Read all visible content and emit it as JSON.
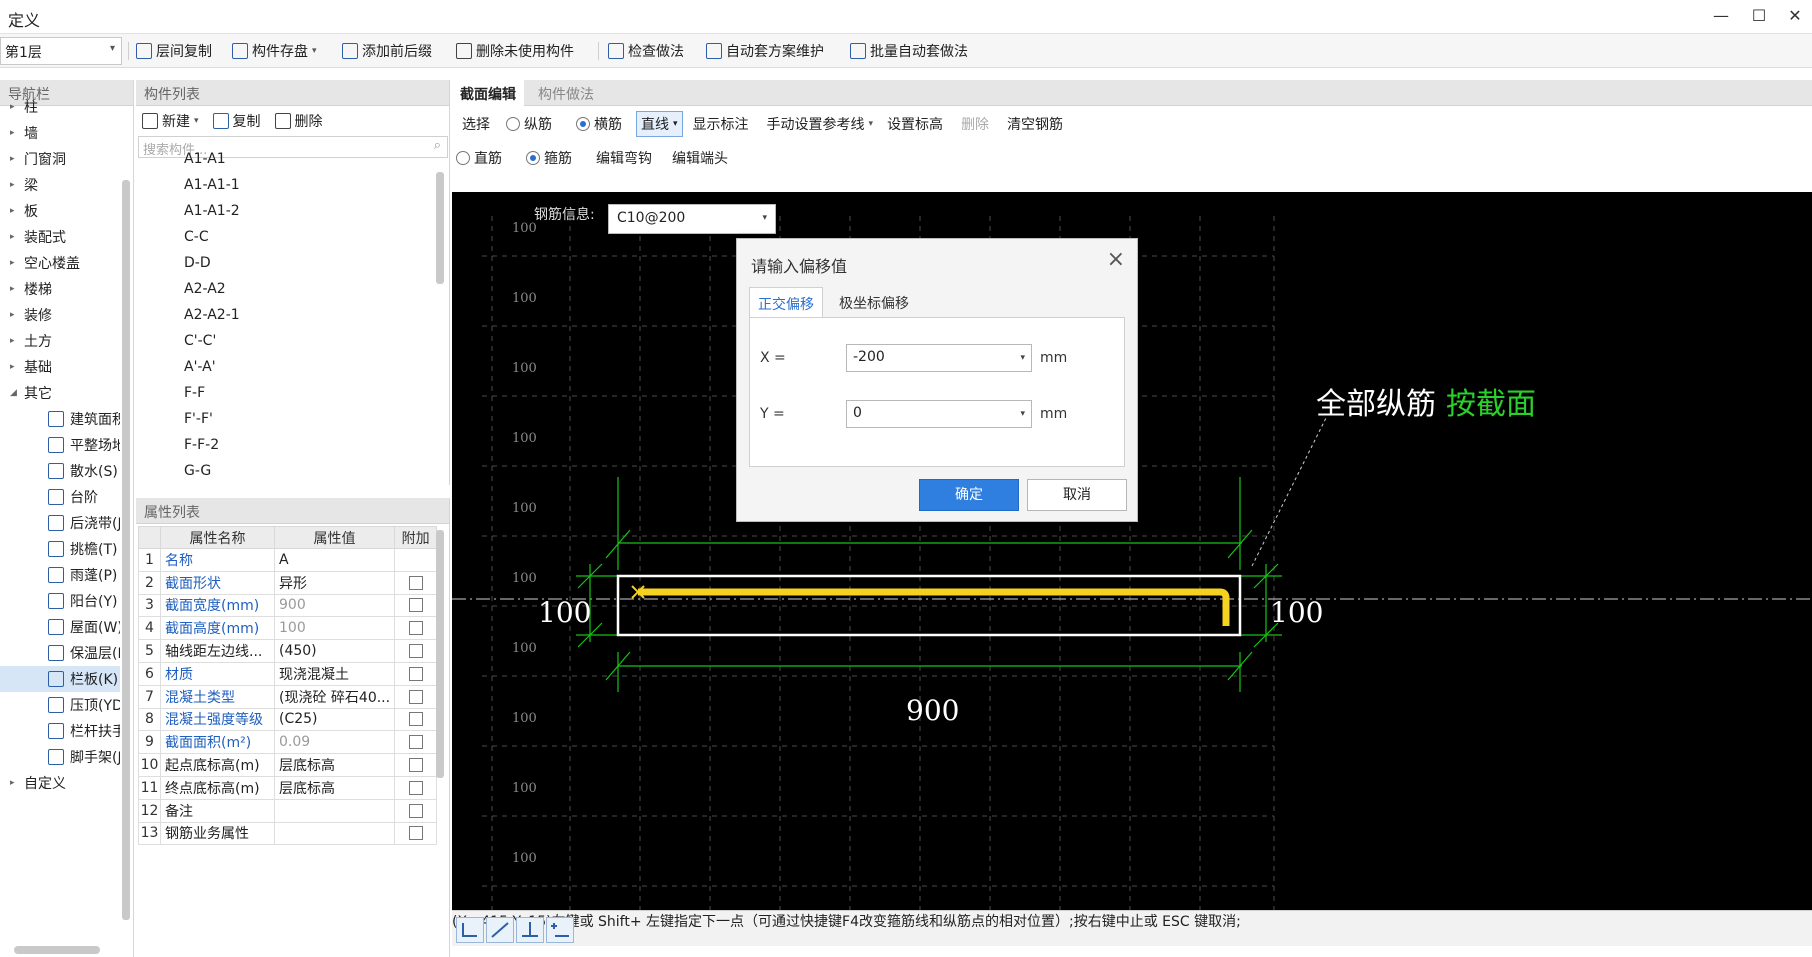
{
  "window": {
    "title": "定义",
    "minimize": "—",
    "maximize": "☐",
    "close": "✕"
  },
  "toolbar": {
    "floor": "第1层",
    "items": [
      "层间复制",
      "构件存盘",
      "添加前后缀",
      "删除未使用构件",
      "检查做法",
      "自动套方案维护",
      "批量自动套做法"
    ]
  },
  "nav": {
    "title": "导航栏",
    "items": [
      "柱",
      "墙",
      "门窗洞",
      "梁",
      "板",
      "装配式",
      "空心楼盖",
      "楼梯",
      "装修",
      "土方",
      "基础",
      "其它"
    ],
    "sub_items": [
      "建筑面积",
      "平整场地",
      "散水(S)",
      "台阶",
      "后浇带(J",
      "挑檐(T)",
      "雨蓬(P)",
      "阳台(Y)",
      "屋面(W)",
      "保温层(H",
      "栏板(K)",
      "压顶(YD)",
      "栏杆扶手",
      "脚手架(J"
    ],
    "last": "自定义"
  },
  "component_list": {
    "title": "构件列表",
    "new": "新建",
    "copy": "复制",
    "delete": "删除",
    "search_placeholder": "搜索构件...",
    "items": [
      "A1-A1",
      "A1-A1-1",
      "A1-A1-2",
      "C-C",
      "D-D",
      "A2-A2",
      "A2-A2-1",
      "C'-C'",
      "A'-A'",
      "F-F",
      "F'-F'",
      "F-F-2",
      "G-G"
    ]
  },
  "properties": {
    "title": "属性列表",
    "headers": [
      "属性名称",
      "属性值",
      "附加"
    ],
    "rows": [
      {
        "n": "1",
        "name": "名称",
        "value": "A"
      },
      {
        "n": "2",
        "name": "截面形状",
        "value": "异形"
      },
      {
        "n": "3",
        "name": "截面宽度(mm)",
        "value": "900"
      },
      {
        "n": "4",
        "name": "截面高度(mm)",
        "value": "100"
      },
      {
        "n": "5",
        "name": "轴线距左边线...",
        "value": "(450)"
      },
      {
        "n": "6",
        "name": "材质",
        "value": "现浇混凝土"
      },
      {
        "n": "7",
        "name": "混凝土类型",
        "value": "(现浇砼 碎石40..."
      },
      {
        "n": "8",
        "name": "混凝土强度等级",
        "value": "(C25)"
      },
      {
        "n": "9",
        "name": "截面面积(m²)",
        "value": "0.09"
      },
      {
        "n": "10",
        "name": "起点底标高(m)",
        "value": "层底标高"
      },
      {
        "n": "11",
        "name": "终点底标高(m)",
        "value": "层底标高"
      },
      {
        "n": "12",
        "name": "备注",
        "value": ""
      },
      {
        "n": "13",
        "name": "钢筋业务属性",
        "value": ""
      }
    ]
  },
  "editor": {
    "tabs": [
      "截面编辑",
      "构件做法"
    ],
    "tool1": {
      "select": "选择",
      "longitudinal": "纵筋",
      "transverse": "横筋",
      "line": "直线",
      "show_dim": "显示标注",
      "manual_ref": "手动设置参考线",
      "set_elev": "设置标高",
      "delete": "删除",
      "clear": "清空钢筋"
    },
    "tool2": {
      "straight": "直筋",
      "stirrup": "箍筋",
      "edit_hook": "编辑弯钩",
      "edit_end": "编辑端头"
    },
    "rebar_info_label": "钢筋信息:",
    "rebar_info_value": "C10@200",
    "grid_labels": [
      "100",
      "100",
      "100",
      "100",
      "100",
      "100",
      "100",
      "100",
      "100",
      "100",
      "100"
    ],
    "dim_left": "100",
    "dim_right": "100",
    "dim_bottom": "900",
    "annotation_white": "全部纵筋",
    "annotation_green": "按截面",
    "status": "(X: -415 Y: 15)左键或 Shift+ 左键指定下一点（可通过快捷键F4改变箍筋线和纵筋点的相对位置）;按右键中止或 ESC 键取消;"
  },
  "dialog": {
    "title": "请输入偏移值",
    "tabs": [
      "正交偏移",
      "极坐标偏移"
    ],
    "x_label": "X =",
    "x_value": "-200",
    "y_label": "Y =",
    "y_value": "0",
    "unit": "mm",
    "ok": "确定",
    "cancel": "取消"
  },
  "colors": {
    "accent": "#2f7fe0",
    "rebar": "#f5d21f",
    "dim": "#16c416",
    "canvas": "#000000"
  }
}
